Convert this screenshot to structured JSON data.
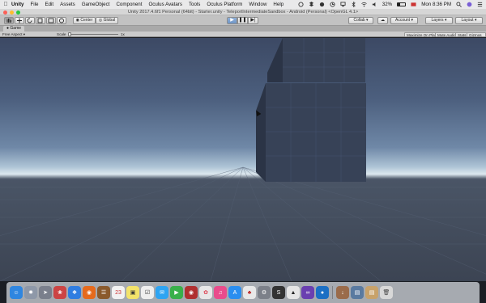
{
  "menubar": {
    "app_name": "Unity",
    "items": [
      "File",
      "Edit",
      "Assets",
      "GameObject",
      "Component",
      "Oculus Avatars",
      "Tools",
      "Oculus Platform",
      "Window",
      "Help"
    ],
    "battery": "32%",
    "battery_level": 0.32,
    "clock": "Mon 8:36 PM"
  },
  "window": {
    "title": "Unity 2017.4.6f1 Personal (64bit) - Starter.unity - TeleportIntermediateSandbox - Android (Personal) <OpenGL 4.1>"
  },
  "toolbar": {
    "center_label": "Center",
    "global_label": "Global",
    "collab_label": "Collab",
    "account_label": "Account",
    "layers_label": "Layers",
    "layout_label": "Layout"
  },
  "game_view": {
    "tab_label": "Game",
    "aspect_label": "Free Aspect",
    "scale_label": "Scale",
    "scale_value": "1x",
    "maximize_label": "Maximize On Play",
    "mute_label": "Mute Audio",
    "stats_label": "Stats",
    "gizmos_label": "Gizmos"
  },
  "dock": {
    "icons": [
      "finder-icon",
      "launchpad-icon",
      "safari-icon",
      "photos-icon",
      "firefox-icon",
      "notes-icon",
      "calendar-icon",
      "stickies-icon",
      "reminders-icon",
      "messages-icon",
      "facetime-icon",
      "photo-booth-icon",
      "itunes-icon",
      "app-store-icon",
      "system-preferences-icon",
      "sublime-icon",
      "unity-icon",
      "visual-studio-icon",
      "trash-icon"
    ]
  },
  "colors": {
    "sky_top": "#3c4964",
    "horizon": "#dde8ef",
    "ground": "#3c4453",
    "cube_front": "#374257",
    "cube_side": "#2b3446"
  }
}
